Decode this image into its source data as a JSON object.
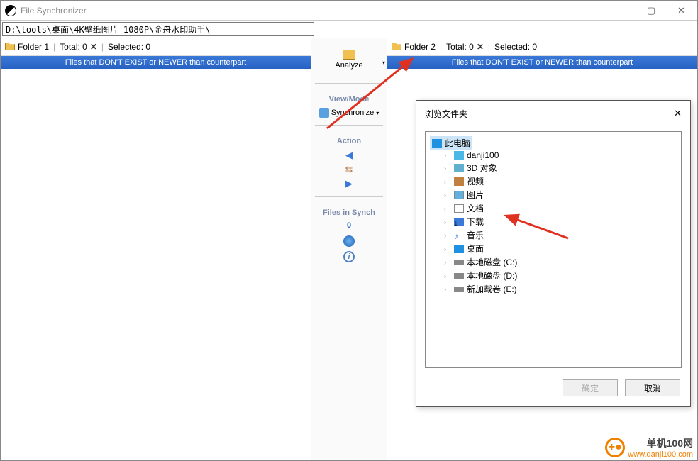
{
  "window": {
    "title": "File Synchronizer"
  },
  "path_input": "D:\\tools\\桌面\\4K壁纸图片 1080P\\金舟水印助手\\",
  "left_panel": {
    "folder_label": "Folder 1",
    "total_label": "Total: 0",
    "selected_label": "Selected: 0",
    "band": "Files that DON'T EXIST or NEWER than counterpart"
  },
  "right_panel": {
    "folder_label": "Folder 2",
    "total_label": "Total: 0",
    "selected_label": "Selected: 0",
    "band": "Files that DON'T EXIST or NEWER than counterpart"
  },
  "center": {
    "analyze": "Analyze",
    "view_mode": "View/Mode",
    "synchronize": "Synchronize",
    "action": "Action",
    "files_in_synch": "Files in Synch",
    "count": "0"
  },
  "dialog": {
    "title": "浏览文件夹",
    "root": "此电脑",
    "items": [
      "danji100",
      "3D 对象",
      "视频",
      "图片",
      "文档",
      "下载",
      "音乐",
      "桌面",
      "本地磁盘 (C:)",
      "本地磁盘 (D:)",
      "新加载卷 (E:)"
    ],
    "ok": "确定",
    "cancel": "取消"
  },
  "watermark": {
    "brand": "单机100网",
    "url": "www.danji100.com"
  }
}
